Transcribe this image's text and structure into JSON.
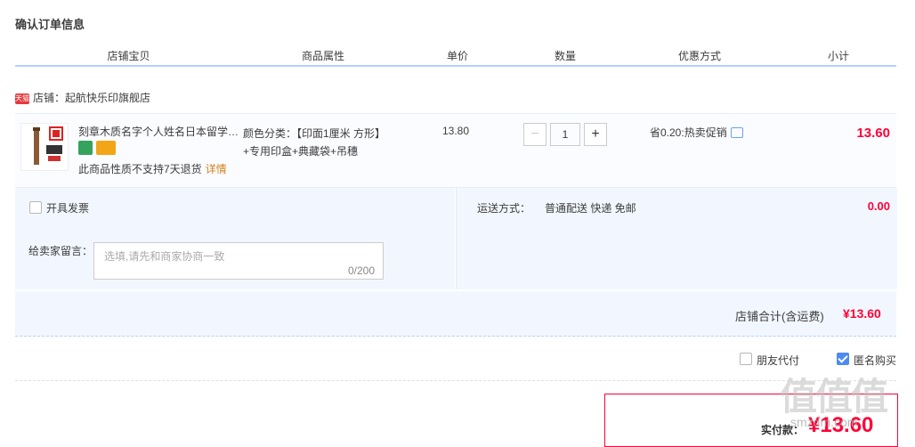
{
  "page_title": "确认订单信息",
  "columns": [
    "店铺宝贝",
    "商品属性",
    "单价",
    "数量",
    "优惠方式",
    "小计"
  ],
  "shop": {
    "badge": "天猫",
    "label": "店铺：起航快乐印旗舰店"
  },
  "item": {
    "name": "刻章木质名字个人姓名日本留学…",
    "note": "此商品性质不支持7天退货",
    "note_link": "详情",
    "sku_line1": "颜色分类：【印面1厘米 方形】",
    "sku_line2": "+专用印盒+典藏袋+吊穗",
    "price": "13.80",
    "qty_minus": "−",
    "qty": "1",
    "qty_plus": "+",
    "promo": "省0.20:热卖促销",
    "subtotal": "13.60"
  },
  "invoice": {
    "label": "开具发票",
    "checked": false
  },
  "message": {
    "label": "给卖家留言：",
    "placeholder": "选填,请先和商家协商一致",
    "counter": "0/200"
  },
  "shipping": {
    "label": "运送方式：",
    "value": "普通配送 快递 免邮",
    "price": "0.00"
  },
  "shop_total": {
    "label": "店铺合计(含运费)",
    "value": "¥13.60"
  },
  "options": {
    "friend_pay": {
      "label": "朋友代付",
      "checked": false
    },
    "anonymous": {
      "label": "匿名购买",
      "checked": true
    }
  },
  "payment": {
    "label": "实付款：",
    "value": "¥13.60"
  },
  "watermark": {
    "text": "值值值",
    "sub": "smzdm.com"
  },
  "colors": {
    "accent": "#ff0036",
    "header_line": "#b2d1ff",
    "panel": "#f2f7ff",
    "check": "#4d8bf0"
  }
}
